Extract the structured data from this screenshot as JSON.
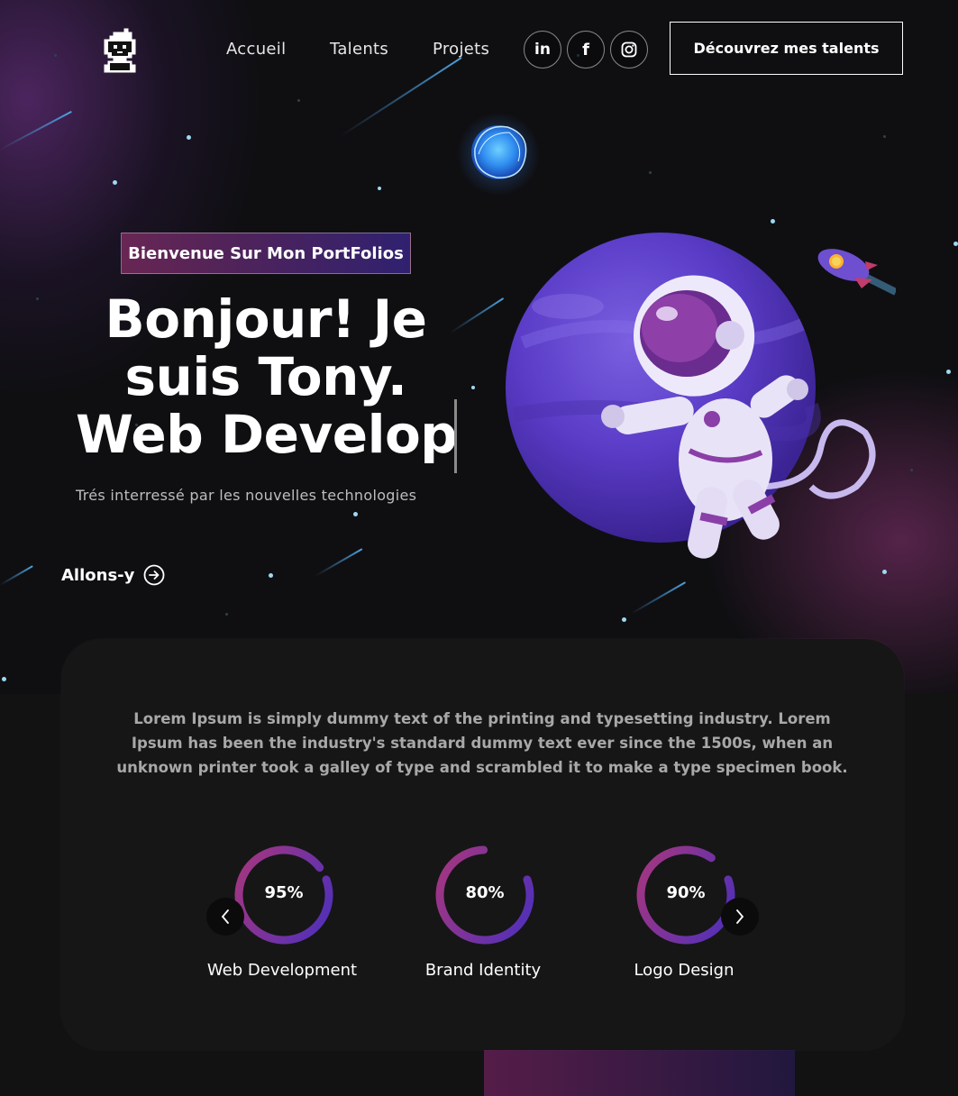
{
  "nav": {
    "logo_icon": "pixel-avatar-icon",
    "links": [
      {
        "label": "Accueil"
      },
      {
        "label": "Talents"
      },
      {
        "label": "Projets"
      }
    ],
    "socials": [
      {
        "icon": "linkedin-icon",
        "label": "in"
      },
      {
        "icon": "facebook-icon",
        "label": "f"
      },
      {
        "icon": "instagram-icon",
        "label": ""
      }
    ],
    "cta_label": "Découvrez mes talents"
  },
  "hero": {
    "tagline": "Bienvenue Sur Mon PortFolios",
    "headline_lines": [
      "Bonjour! Je",
      "suis Tony.",
      "Web Develop"
    ],
    "subline": "Trés interressé par les nouvelles technologies",
    "action_label": "Allons-y",
    "action_icon": "arrow-right-circle-icon"
  },
  "skills": {
    "intro": "Lorem Ipsum is simply dummy text of the printing and typesetting industry. Lorem Ipsum has been the industry's standard dummy text ever since the 1500s, when an unknown printer took a galley of type and scrambled it to make a type specimen book.",
    "items": [
      {
        "percent_label": "95%",
        "percent": 95,
        "label": "Web Development"
      },
      {
        "percent_label": "80%",
        "percent": 80,
        "label": "Brand Identity"
      },
      {
        "percent_label": "90%",
        "percent": 90,
        "label": "Logo Design"
      }
    ],
    "prev_icon": "chevron-left-icon",
    "next_icon": "chevron-right-icon"
  },
  "colors": {
    "accent_pink": "#aa367c",
    "accent_purple": "#4a2fbd",
    "background": "#121212",
    "card": "#161616"
  }
}
